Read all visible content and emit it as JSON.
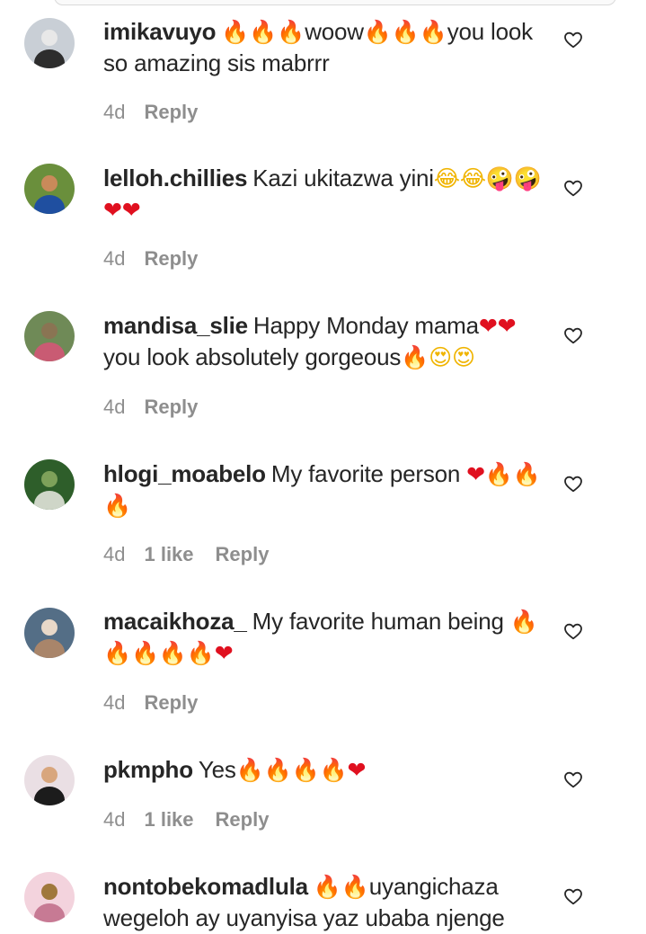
{
  "comments": [
    {
      "username": "imikavuyo",
      "avatar_desc": "avatar",
      "segments": [
        {
          "t": "emoji",
          "v": "🔥",
          "k": "fire"
        },
        {
          "t": "emoji",
          "v": "🔥",
          "k": "fire"
        },
        {
          "t": "emoji",
          "v": "🔥",
          "k": "fire"
        },
        {
          "t": "text",
          "v": "woow"
        },
        {
          "t": "emoji",
          "v": "🔥",
          "k": "fire"
        },
        {
          "t": "emoji",
          "v": "🔥",
          "k": "fire"
        },
        {
          "t": "emoji",
          "v": "🔥",
          "k": "fire"
        },
        {
          "t": "text",
          "v": "you look so amazing sis mabrrr"
        }
      ],
      "time": "4d",
      "likes": "",
      "reply": "Reply"
    },
    {
      "username": "lelloh.chillies",
      "segments": [
        {
          "t": "text",
          "v": "Kazi ukitazwa yini"
        },
        {
          "t": "emoji",
          "v": "😂",
          "k": "laugh"
        },
        {
          "t": "emoji",
          "v": "😂",
          "k": "laugh"
        },
        {
          "t": "emoji",
          "v": "🤪",
          "k": "crazy"
        },
        {
          "t": "emoji",
          "v": "🤪",
          "k": "crazy"
        },
        {
          "t": "emoji",
          "v": "❤",
          "k": "red"
        },
        {
          "t": "emoji",
          "v": "❤",
          "k": "red"
        }
      ],
      "time": "4d",
      "likes": "",
      "reply": "Reply"
    },
    {
      "username": "mandisa_slie",
      "segments": [
        {
          "t": "text",
          "v": "Happy Monday mama"
        },
        {
          "t": "emoji",
          "v": "❤",
          "k": "red"
        },
        {
          "t": "emoji",
          "v": "❤",
          "k": "red"
        },
        {
          "t": "text",
          "v": " you look absolutely gorgeous"
        },
        {
          "t": "emoji",
          "v": "🔥",
          "k": "fire"
        },
        {
          "t": "emoji",
          "v": "😍",
          "k": "love"
        },
        {
          "t": "emoji",
          "v": "😍",
          "k": "love"
        }
      ],
      "time": "4d",
      "likes": "",
      "reply": "Reply"
    },
    {
      "username": "hlogi_moabelo",
      "segments": [
        {
          "t": "text",
          "v": "My favorite person "
        },
        {
          "t": "emoji",
          "v": "❤",
          "k": "red"
        },
        {
          "t": "emoji",
          "v": "🔥",
          "k": "fire"
        },
        {
          "t": "emoji",
          "v": "🔥",
          "k": "fire"
        },
        {
          "t": "emoji",
          "v": "🔥",
          "k": "fire"
        }
      ],
      "time": "4d",
      "likes": "1 like",
      "reply": "Reply"
    },
    {
      "username": "macaikhoza_",
      "segments": [
        {
          "t": "text",
          "v": "My favorite human being "
        },
        {
          "t": "emoji",
          "v": "🔥",
          "k": "fire"
        },
        {
          "t": "emoji",
          "v": "🔥",
          "k": "fire"
        },
        {
          "t": "emoji",
          "v": "🔥",
          "k": "fire"
        },
        {
          "t": "emoji",
          "v": "🔥",
          "k": "fire"
        },
        {
          "t": "emoji",
          "v": "🔥",
          "k": "fire"
        },
        {
          "t": "emoji",
          "v": "❤",
          "k": "red"
        }
      ],
      "time": "4d",
      "likes": "",
      "reply": "Reply"
    },
    {
      "username": "pkmpho",
      "segments": [
        {
          "t": "text",
          "v": "Yes"
        },
        {
          "t": "emoji",
          "v": "🔥",
          "k": "fire"
        },
        {
          "t": "emoji",
          "v": "🔥",
          "k": "fire"
        },
        {
          "t": "emoji",
          "v": "🔥",
          "k": "fire"
        },
        {
          "t": "emoji",
          "v": "🔥",
          "k": "fire"
        },
        {
          "t": "emoji",
          "v": "❤",
          "k": "red"
        }
      ],
      "time": "4d",
      "likes": "1 like",
      "reply": "Reply"
    },
    {
      "username": "nontobekomadlula",
      "segments": [
        {
          "t": "emoji",
          "v": "🔥",
          "k": "fire"
        },
        {
          "t": "emoji",
          "v": "🔥",
          "k": "fire"
        },
        {
          "t": "text",
          "v": "uyangichaza wegeloh ay uyanyisa yaz ubaba njenge"
        }
      ],
      "time": "",
      "likes": "",
      "reply": ""
    }
  ],
  "colors": {
    "username": "#262626",
    "meta": "#8e8e8e",
    "fire": "#f26a1b",
    "heart_red": "#e0101f"
  },
  "icons": {
    "like": "heart-outline-icon"
  }
}
